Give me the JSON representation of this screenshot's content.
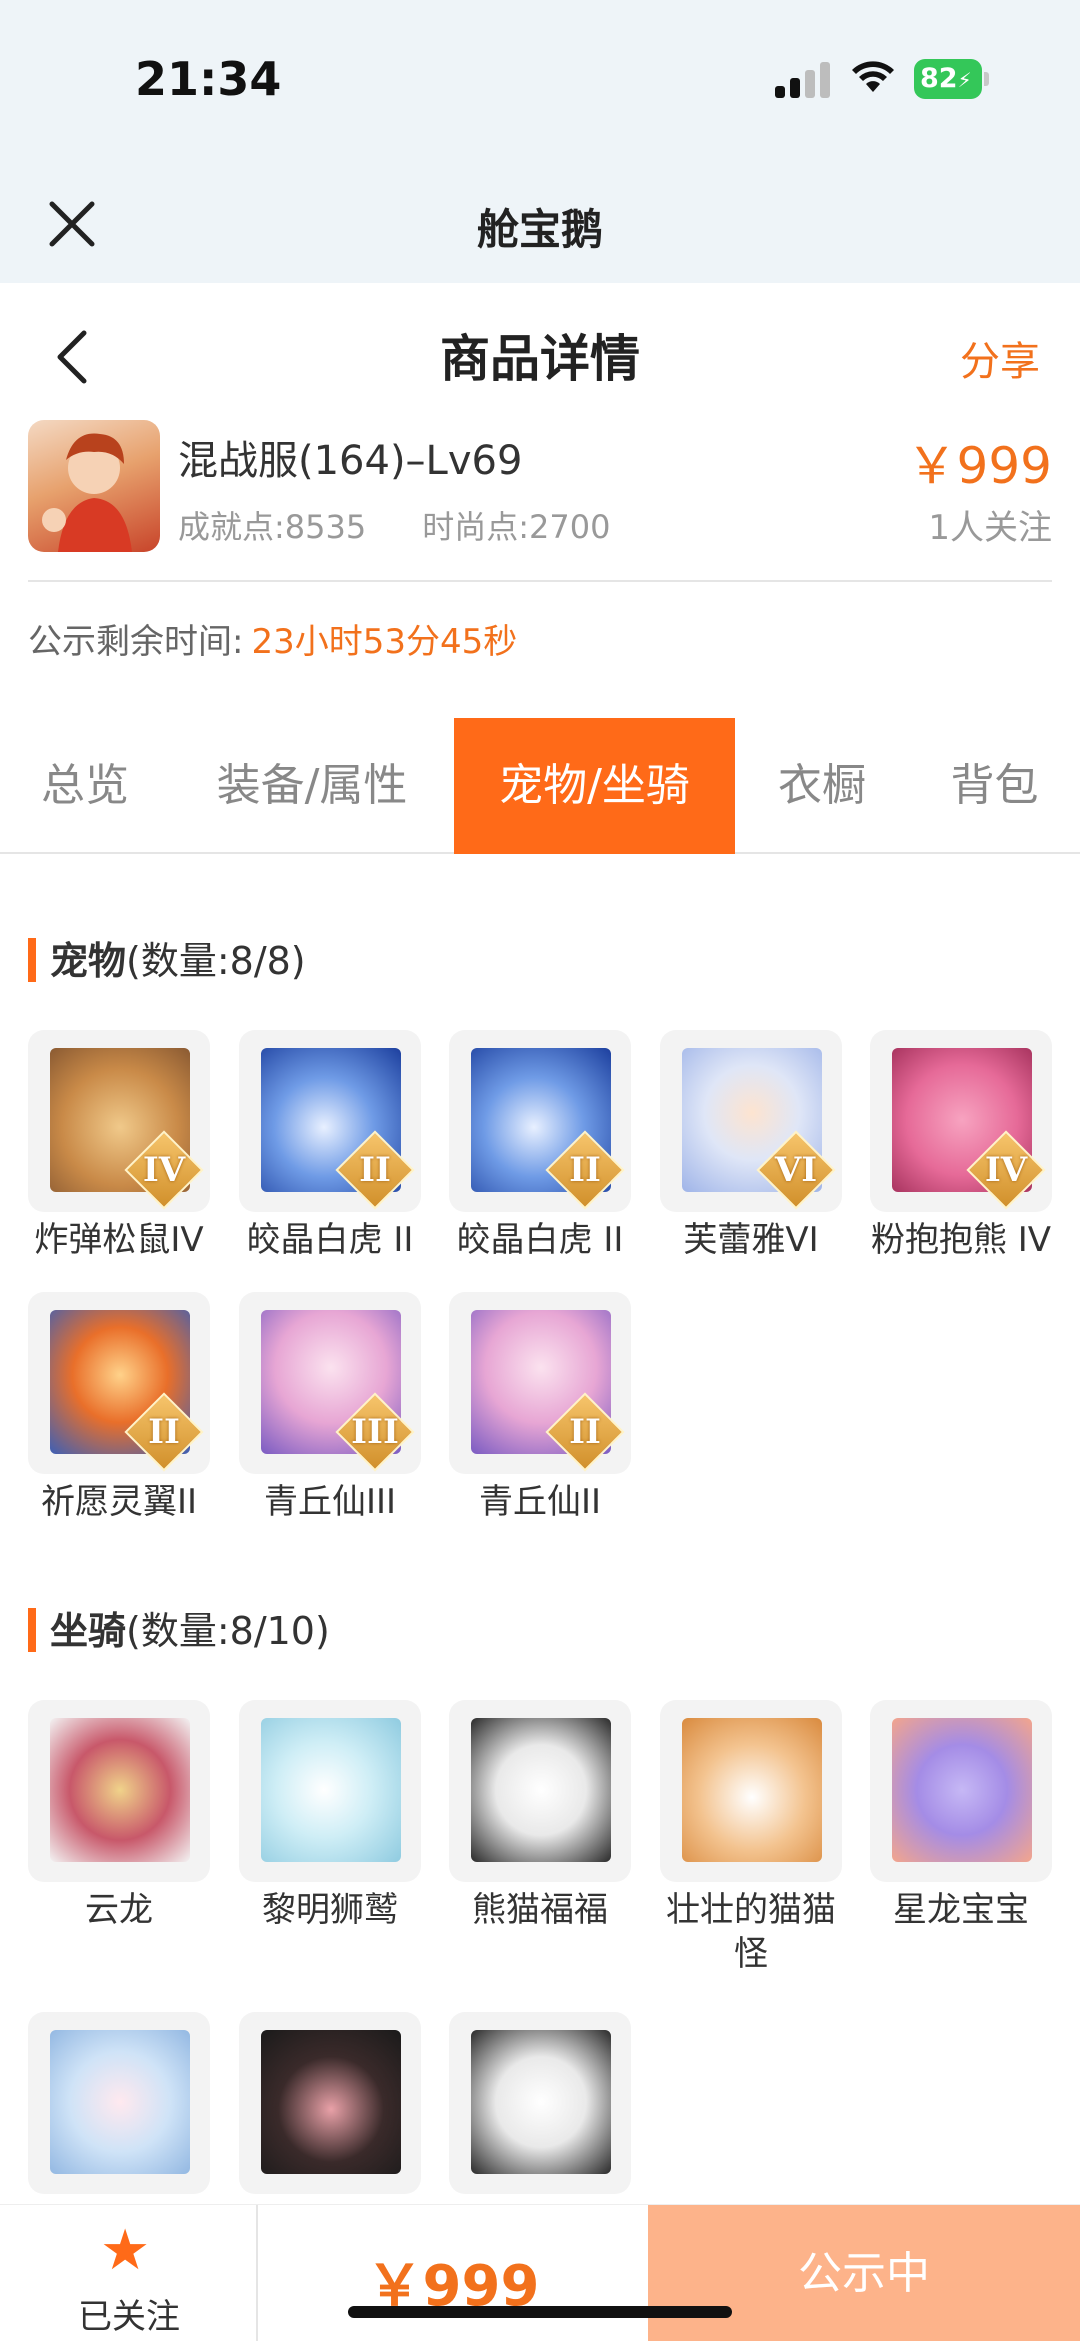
{
  "status_bar": {
    "time": "21:34",
    "battery": "82"
  },
  "app_bar": {
    "title": "舱宝鹅"
  },
  "header": {
    "title": "商品详情",
    "share": "分享"
  },
  "product": {
    "name": "混战服(164)–Lv69",
    "achievement": "成就点:8535",
    "fashion": "时尚点:2700",
    "price": "￥999",
    "followers": "1人关注"
  },
  "countdown": {
    "label": "公示剩余时间:",
    "value": "23小时53分45秒"
  },
  "tabs": [
    "总览",
    "装备/属性",
    "宠物/坐骑",
    "衣橱",
    "背包"
  ],
  "active_tab": "宠物/坐骑",
  "pets": {
    "title": "宠物",
    "count": "(数量:8/8)",
    "items": [
      {
        "name": "炸弹松鼠IV",
        "tier": "IV"
      },
      {
        "name": "皎晶白虎 II",
        "tier": "II"
      },
      {
        "name": "皎晶白虎 II",
        "tier": "II"
      },
      {
        "name": "芙蕾雅VI",
        "tier": "VI"
      },
      {
        "name": "粉抱抱熊 IV",
        "tier": "IV"
      },
      {
        "name": "祈愿灵翼II",
        "tier": "II"
      },
      {
        "name": "青丘仙III",
        "tier": "III"
      },
      {
        "name": "青丘仙II",
        "tier": "II"
      }
    ]
  },
  "mounts": {
    "title": "坐骑",
    "count": "(数量:8/10)",
    "items": [
      {
        "name": "云龙"
      },
      {
        "name": "黎明狮鹫"
      },
      {
        "name": "熊猫福福"
      },
      {
        "name": "壮壮的猫猫怪"
      },
      {
        "name": "星龙宝宝"
      },
      {
        "name": ""
      },
      {
        "name": ""
      },
      {
        "name": ""
      }
    ]
  },
  "bottom_bar": {
    "followed": "已关注",
    "price": "￥999",
    "status": "公示中"
  },
  "colors": {
    "accent": "#ff6a18",
    "price": "#f2711c",
    "status_button": "#fdb38a"
  }
}
